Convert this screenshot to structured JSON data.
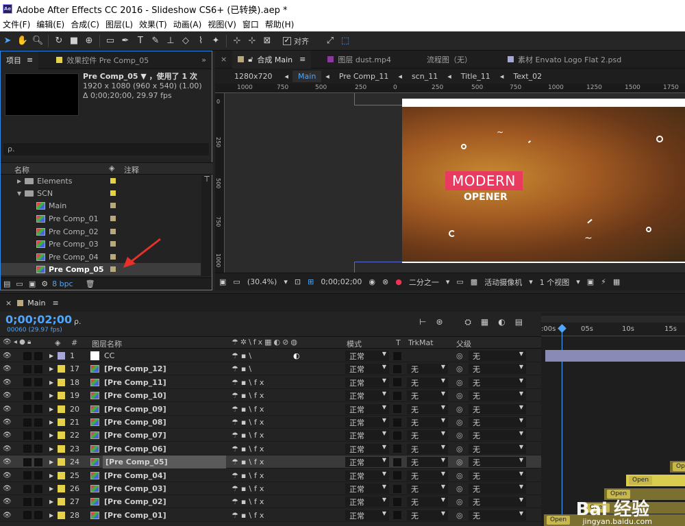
{
  "window": {
    "title": "Adobe After Effects CC 2016 - Slideshow CS6+ (已转换).aep *",
    "app_badge": "Ae"
  },
  "menu": [
    "文件(F)",
    "编辑(E)",
    "合成(C)",
    "图层(L)",
    "效果(T)",
    "动画(A)",
    "视图(V)",
    "窗口",
    "帮助(H)"
  ],
  "toolbar": {
    "snap_label": "对齐"
  },
  "project_panel": {
    "tab_project": "项目",
    "tab_effects": "效果控件 Pre Comp_05",
    "info": {
      "name": "Pre Comp_05 ▼ ，使用了 1 次",
      "line2": "1920 x 1080  (960 x 540) (1.00)",
      "line3": "Δ 0;00;20;00, 29.97 fps"
    },
    "search_placeholder": "ρ.",
    "col_name": "名称",
    "col_comment": "注释",
    "items": [
      {
        "label": "Elements",
        "type": "folder",
        "indent": 0,
        "color": "#e3d24a"
      },
      {
        "label": "SCN",
        "type": "folder-open",
        "indent": 0,
        "color": "#e3d24a"
      },
      {
        "label": "Main",
        "type": "comp",
        "indent": 1,
        "color": "#b9a87e"
      },
      {
        "label": "Pre Comp_01",
        "type": "comp",
        "indent": 1,
        "color": "#b9a87e"
      },
      {
        "label": "Pre Comp_02",
        "type": "comp",
        "indent": 1,
        "color": "#b9a87e"
      },
      {
        "label": "Pre Comp_03",
        "type": "comp",
        "indent": 1,
        "color": "#b9a87e"
      },
      {
        "label": "Pre Comp_04",
        "type": "comp",
        "indent": 1,
        "color": "#b9a87e"
      },
      {
        "label": "Pre Comp_05",
        "type": "comp",
        "indent": 1,
        "color": "#b9a87e",
        "selected": true
      }
    ],
    "bpc": "8 bpc"
  },
  "viewer": {
    "tabs": [
      "合成 Main",
      "图层 dust.mp4",
      "流程图（无）",
      "素材 Envato Logo Flat 2.psd"
    ],
    "resolution": "1280x720",
    "breadcrumbs": [
      "Main",
      "Pre Comp_11",
      "scn_11",
      "Title_11",
      "Text_02"
    ],
    "ruler_top": [
      "1000",
      "750",
      "500",
      "250",
      "0",
      "250",
      "500",
      "750",
      "1000",
      "1250",
      "1500",
      "1750"
    ],
    "ruler_left": [
      "0",
      "250",
      "500",
      "750",
      "1000"
    ],
    "art_title": "MODERN",
    "art_subtitle": "OPENER",
    "zoom": "(30.4%)",
    "timecode": "0;00;02;00",
    "quality": "二分之一",
    "camera": "活动摄像机",
    "views": "1 个视图"
  },
  "timeline": {
    "tab": "Main",
    "timecode": "0;00;02;00",
    "fps": "00060 (29.97 fps)",
    "headers": {
      "num": "#",
      "name": "图层名称",
      "mode": "模式",
      "t": "T",
      "trkmat": "TrkMat",
      "parent": "父级"
    },
    "ruler": [
      ":00s",
      "05s",
      "10s",
      "15s"
    ],
    "layers": [
      {
        "num": "1",
        "name": "CC",
        "color": "#a7a7d6",
        "mode": "正常",
        "trkmat": "",
        "parent": "无"
      },
      {
        "num": "17",
        "name": "[Pre Comp_12]",
        "color": "#e3d24a",
        "mode": "正常",
        "trkmat": "无",
        "parent": "无"
      },
      {
        "num": "18",
        "name": "[Pre Comp_11]",
        "color": "#e3d24a",
        "mode": "正常",
        "trkmat": "无",
        "parent": "无"
      },
      {
        "num": "19",
        "name": "[Pre Comp_10]",
        "color": "#e3d24a",
        "mode": "正常",
        "trkmat": "无",
        "parent": "无"
      },
      {
        "num": "20",
        "name": "[Pre Comp_09]",
        "color": "#e3d24a",
        "mode": "正常",
        "trkmat": "无",
        "parent": "无"
      },
      {
        "num": "21",
        "name": "[Pre Comp_08]",
        "color": "#e3d24a",
        "mode": "正常",
        "trkmat": "无",
        "parent": "无"
      },
      {
        "num": "22",
        "name": "[Pre Comp_07]",
        "color": "#e3d24a",
        "mode": "正常",
        "trkmat": "无",
        "parent": "无"
      },
      {
        "num": "23",
        "name": "[Pre Comp_06]",
        "color": "#e3d24a",
        "mode": "正常",
        "trkmat": "无",
        "parent": "无"
      },
      {
        "num": "24",
        "name": "[Pre Comp_05]",
        "color": "#e3d24a",
        "mode": "正常",
        "trkmat": "无",
        "parent": "无",
        "selected": true
      },
      {
        "num": "25",
        "name": "[Pre Comp_04]",
        "color": "#e3d24a",
        "mode": "正常",
        "trkmat": "无",
        "parent": "无"
      },
      {
        "num": "26",
        "name": "[Pre Comp_03]",
        "color": "#e3d24a",
        "mode": "正常",
        "trkmat": "无",
        "parent": "无"
      },
      {
        "num": "27",
        "name": "[Pre Comp_02]",
        "color": "#e3d24a",
        "mode": "正常",
        "trkmat": "无",
        "parent": "无"
      },
      {
        "num": "28",
        "name": "[Pre Comp_01]",
        "color": "#e3d24a",
        "mode": "正常",
        "trkmat": "无",
        "parent": "无"
      }
    ],
    "bar_labels": [
      "Op",
      "Open",
      "Open",
      "Open",
      "Open"
    ]
  },
  "watermark": {
    "brand": "Bai 经验",
    "url": "jingyan.baidu.com"
  }
}
